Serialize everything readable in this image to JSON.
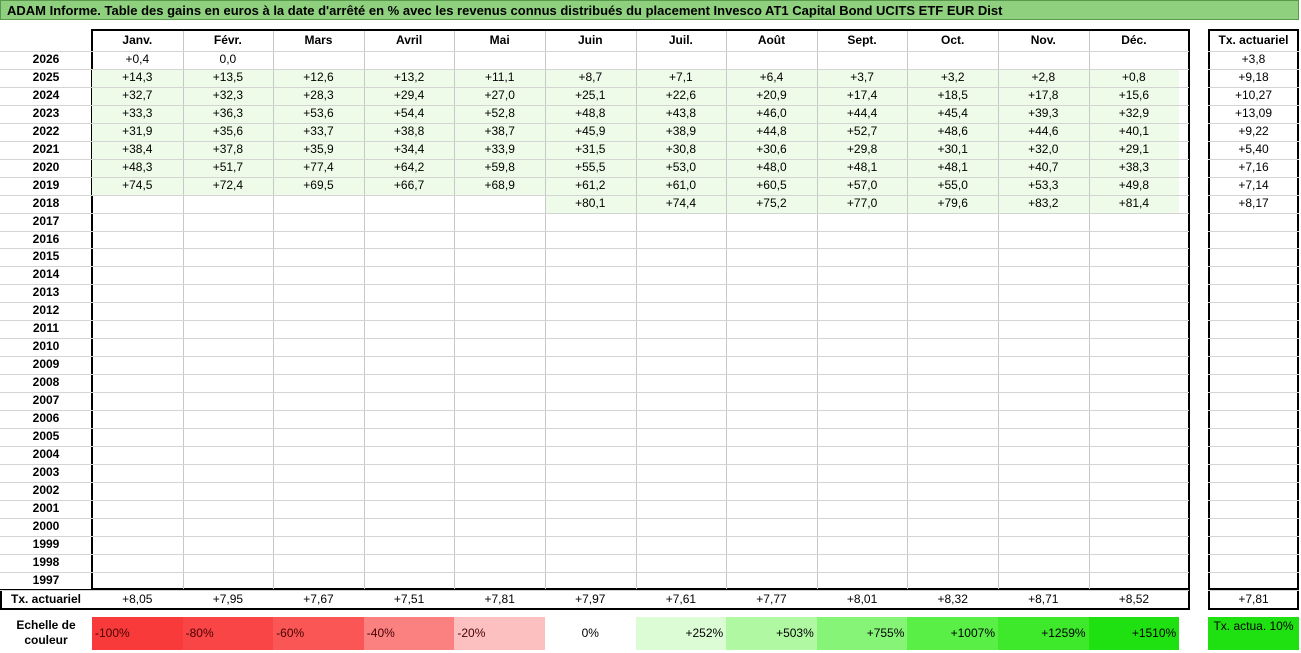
{
  "title": "ADAM Informe. Table des gains en euros à la date d'arrêté en % avec les revenus connus distribués du placement Invesco AT1 Capital Bond UCITS ETF EUR Dist",
  "months": [
    "Janv.",
    "Févr.",
    "Mars",
    "Avril",
    "Mai",
    "Juin",
    "Juil.",
    "Août",
    "Sept.",
    "Oct.",
    "Nov.",
    "Déc."
  ],
  "tx_header": "Tx. actuariel",
  "rows": [
    {
      "year": "2026",
      "values": [
        "+0,4",
        "0,0",
        "",
        "",
        "",
        "",
        "",
        "",
        "",
        "",
        "",
        ""
      ],
      "tx": "+3,8"
    },
    {
      "year": "2025",
      "values": [
        "+14,3",
        "+13,5",
        "+12,6",
        "+13,2",
        "+11,1",
        "+8,7",
        "+7,1",
        "+6,4",
        "+3,7",
        "+3,2",
        "+2,8",
        "+0,8"
      ],
      "tx": "+9,18"
    },
    {
      "year": "2024",
      "values": [
        "+32,7",
        "+32,3",
        "+28,3",
        "+29,4",
        "+27,0",
        "+25,1",
        "+22,6",
        "+20,9",
        "+17,4",
        "+18,5",
        "+17,8",
        "+15,6"
      ],
      "tx": "+10,27"
    },
    {
      "year": "2023",
      "values": [
        "+33,3",
        "+36,3",
        "+53,6",
        "+54,4",
        "+52,8",
        "+48,8",
        "+43,8",
        "+46,0",
        "+44,4",
        "+45,4",
        "+39,3",
        "+32,9"
      ],
      "tx": "+13,09"
    },
    {
      "year": "2022",
      "values": [
        "+31,9",
        "+35,6",
        "+33,7",
        "+38,8",
        "+38,7",
        "+45,9",
        "+38,9",
        "+44,8",
        "+52,7",
        "+48,6",
        "+44,6",
        "+40,1"
      ],
      "tx": "+9,22"
    },
    {
      "year": "2021",
      "values": [
        "+38,4",
        "+37,8",
        "+35,9",
        "+34,4",
        "+33,9",
        "+31,5",
        "+30,8",
        "+30,6",
        "+29,8",
        "+30,1",
        "+32,0",
        "+29,1"
      ],
      "tx": "+5,40"
    },
    {
      "year": "2020",
      "values": [
        "+48,3",
        "+51,7",
        "+77,4",
        "+64,2",
        "+59,8",
        "+55,5",
        "+53,0",
        "+48,0",
        "+48,1",
        "+48,1",
        "+40,7",
        "+38,3"
      ],
      "tx": "+7,16"
    },
    {
      "year": "2019",
      "values": [
        "+74,5",
        "+72,4",
        "+69,5",
        "+66,7",
        "+68,9",
        "+61,2",
        "+61,0",
        "+60,5",
        "+57,0",
        "+55,0",
        "+53,3",
        "+49,8"
      ],
      "tx": "+7,14"
    },
    {
      "year": "2018",
      "values": [
        "",
        "",
        "",
        "",
        "",
        "+80,1",
        "+74,4",
        "+75,2",
        "+77,0",
        "+79,6",
        "+83,2",
        "+81,4"
      ],
      "tx": "+8,17"
    },
    {
      "year": "2017",
      "values": [
        "",
        "",
        "",
        "",
        "",
        "",
        "",
        "",
        "",
        "",
        "",
        ""
      ],
      "tx": ""
    },
    {
      "year": "2016",
      "values": [
        "",
        "",
        "",
        "",
        "",
        "",
        "",
        "",
        "",
        "",
        "",
        ""
      ],
      "tx": ""
    },
    {
      "year": "2015",
      "values": [
        "",
        "",
        "",
        "",
        "",
        "",
        "",
        "",
        "",
        "",
        "",
        ""
      ],
      "tx": ""
    },
    {
      "year": "2014",
      "values": [
        "",
        "",
        "",
        "",
        "",
        "",
        "",
        "",
        "",
        "",
        "",
        ""
      ],
      "tx": ""
    },
    {
      "year": "2013",
      "values": [
        "",
        "",
        "",
        "",
        "",
        "",
        "",
        "",
        "",
        "",
        "",
        ""
      ],
      "tx": ""
    },
    {
      "year": "2012",
      "values": [
        "",
        "",
        "",
        "",
        "",
        "",
        "",
        "",
        "",
        "",
        "",
        ""
      ],
      "tx": ""
    },
    {
      "year": "2011",
      "values": [
        "",
        "",
        "",
        "",
        "",
        "",
        "",
        "",
        "",
        "",
        "",
        ""
      ],
      "tx": ""
    },
    {
      "year": "2010",
      "values": [
        "",
        "",
        "",
        "",
        "",
        "",
        "",
        "",
        "",
        "",
        "",
        ""
      ],
      "tx": ""
    },
    {
      "year": "2009",
      "values": [
        "",
        "",
        "",
        "",
        "",
        "",
        "",
        "",
        "",
        "",
        "",
        ""
      ],
      "tx": ""
    },
    {
      "year": "2008",
      "values": [
        "",
        "",
        "",
        "",
        "",
        "",
        "",
        "",
        "",
        "",
        "",
        ""
      ],
      "tx": ""
    },
    {
      "year": "2007",
      "values": [
        "",
        "",
        "",
        "",
        "",
        "",
        "",
        "",
        "",
        "",
        "",
        ""
      ],
      "tx": ""
    },
    {
      "year": "2006",
      "values": [
        "",
        "",
        "",
        "",
        "",
        "",
        "",
        "",
        "",
        "",
        "",
        ""
      ],
      "tx": ""
    },
    {
      "year": "2005",
      "values": [
        "",
        "",
        "",
        "",
        "",
        "",
        "",
        "",
        "",
        "",
        "",
        ""
      ],
      "tx": ""
    },
    {
      "year": "2004",
      "values": [
        "",
        "",
        "",
        "",
        "",
        "",
        "",
        "",
        "",
        "",
        "",
        ""
      ],
      "tx": ""
    },
    {
      "year": "2003",
      "values": [
        "",
        "",
        "",
        "",
        "",
        "",
        "",
        "",
        "",
        "",
        "",
        ""
      ],
      "tx": ""
    },
    {
      "year": "2002",
      "values": [
        "",
        "",
        "",
        "",
        "",
        "",
        "",
        "",
        "",
        "",
        "",
        ""
      ],
      "tx": ""
    },
    {
      "year": "2001",
      "values": [
        "",
        "",
        "",
        "",
        "",
        "",
        "",
        "",
        "",
        "",
        "",
        ""
      ],
      "tx": ""
    },
    {
      "year": "2000",
      "values": [
        "",
        "",
        "",
        "",
        "",
        "",
        "",
        "",
        "",
        "",
        "",
        ""
      ],
      "tx": ""
    },
    {
      "year": "1999",
      "values": [
        "",
        "",
        "",
        "",
        "",
        "",
        "",
        "",
        "",
        "",
        "",
        ""
      ],
      "tx": ""
    },
    {
      "year": "1998",
      "values": [
        "",
        "",
        "",
        "",
        "",
        "",
        "",
        "",
        "",
        "",
        "",
        ""
      ],
      "tx": ""
    },
    {
      "year": "1997",
      "values": [
        "",
        "",
        "",
        "",
        "",
        "",
        "",
        "",
        "",
        "",
        "",
        ""
      ],
      "tx": ""
    }
  ],
  "footer": {
    "label": "Tx. actuariel",
    "values": [
      "+8,05",
      "+7,95",
      "+7,67",
      "+7,51",
      "+7,81",
      "+7,97",
      "+7,61",
      "+7,77",
      "+8,01",
      "+8,32",
      "+8,71",
      "+8,52"
    ],
    "total": "+7,81"
  },
  "scale": {
    "label": "Echelle de couleur",
    "items": [
      {
        "text": "-100%",
        "color": "#f83a3a"
      },
      {
        "text": "-80%",
        "color": "#f94545"
      },
      {
        "text": "-60%",
        "color": "#fa5656"
      },
      {
        "text": "-40%",
        "color": "#fb8181"
      },
      {
        "text": "-20%",
        "color": "#fcc0c0"
      },
      {
        "text": "0%",
        "color": "#ffffff"
      },
      {
        "text": "+252%",
        "color": "#dcfcd6"
      },
      {
        "text": "+503%",
        "color": "#b0f8a2"
      },
      {
        "text": "+755%",
        "color": "#86f577"
      },
      {
        "text": "+1007%",
        "color": "#59ef47"
      },
      {
        "text": "+1259%",
        "color": "#3ee92c"
      },
      {
        "text": "+1510%",
        "color": "#1fe010"
      }
    ],
    "tx_label": "Tx. actua. 10%",
    "tx_color": "#1fe010"
  }
}
